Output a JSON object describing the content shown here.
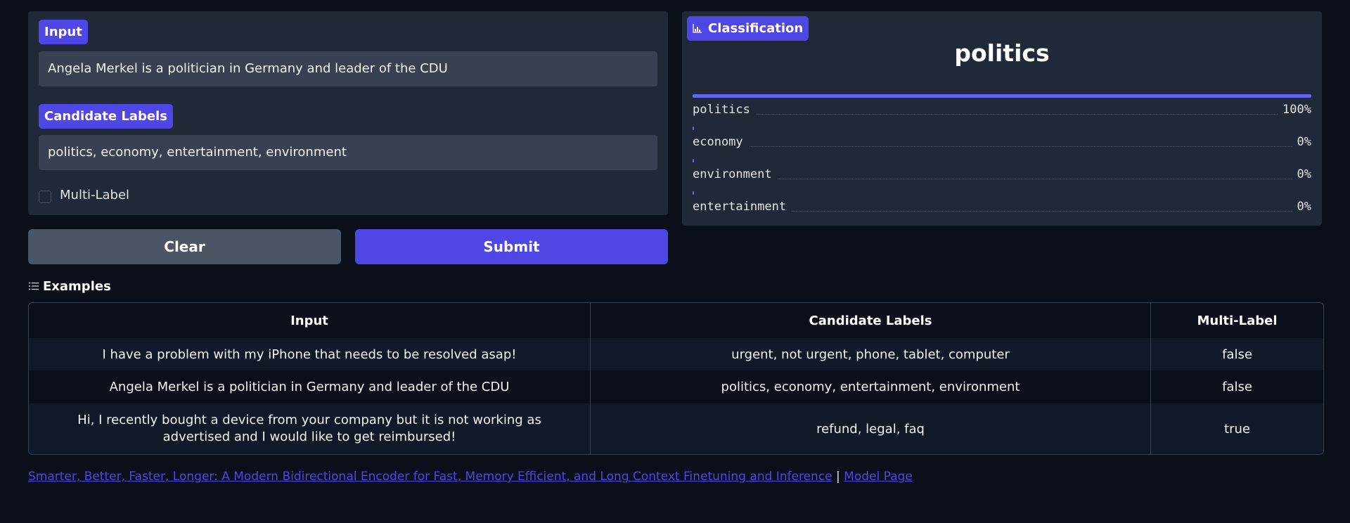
{
  "input_panel": {
    "input_label": "Input",
    "input_value": "Angela Merkel is a politician in Germany and leader of the CDU",
    "labels_label": "Candidate Labels",
    "labels_value": "politics, economy, entertainment, environment",
    "multilabel_label": "Multi-Label",
    "multilabel_checked": false
  },
  "buttons": {
    "clear": "Clear",
    "submit": "Submit"
  },
  "output_panel": {
    "badge": "Classification",
    "top_label": "politics",
    "confidences": [
      {
        "label": "politics",
        "value": "100%",
        "fraction": 1.0
      },
      {
        "label": "economy",
        "value": "0%",
        "fraction": 0.0
      },
      {
        "label": "environment",
        "value": "0%",
        "fraction": 0.0
      },
      {
        "label": "entertainment",
        "value": "0%",
        "fraction": 0.0
      }
    ]
  },
  "examples": {
    "title": "Examples",
    "headers": [
      "Input",
      "Candidate Labels",
      "Multi-Label"
    ],
    "rows": [
      [
        "I have a problem with my iPhone that needs to be resolved asap!",
        "urgent, not urgent, phone, tablet, computer",
        "false"
      ],
      [
        "Angela Merkel is a politician in Germany and leader of the CDU",
        "politics, economy, entertainment, environment",
        "false"
      ],
      [
        "Hi, I recently bought a device from your company but it is not working as advertised and I would like to get reimbursed!",
        "refund, legal, faq",
        "true"
      ]
    ]
  },
  "footer": {
    "paper_link": "Smarter, Better, Faster, Longer: A Modern Bidirectional Encoder for Fast, Memory Efficient, and Long Context Finetuning and Inference",
    "separator": "|",
    "model_link": "Model Page"
  },
  "colors": {
    "accent": "#4f46e5",
    "background": "#0b0f19",
    "panel": "#1f2937",
    "input_bg": "#374151",
    "clear_button": "#4b5563"
  },
  "icons": {
    "output_badge": "bar-chart-icon",
    "examples": "list-icon"
  }
}
